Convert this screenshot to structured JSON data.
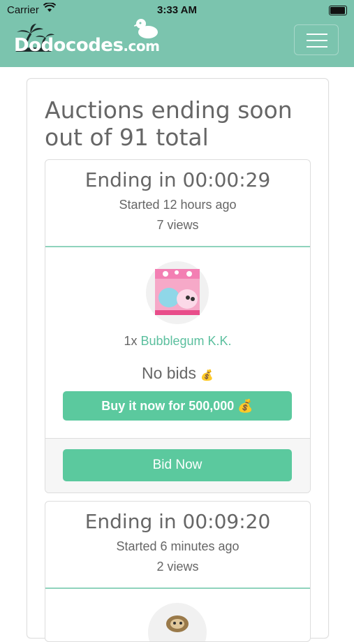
{
  "status": {
    "carrier": "Carrier",
    "time": "3:33 AM"
  },
  "nav": {
    "brand_a": "Dodo",
    "brand_b": "codes",
    "brand_c": ".com"
  },
  "page": {
    "title_line1": "Auctions ending soon",
    "title_line2": "out of 91 total"
  },
  "auctions": [
    {
      "ending": "Ending in 00:00:29",
      "started": "Started 12 hours ago",
      "views": "7 views",
      "quantity": "1x",
      "item_name": "Bubblegum K.K.",
      "bids": "No bids",
      "buy_now": "Buy it now for 500,000",
      "bid_button": "Bid Now"
    },
    {
      "ending": "Ending in 00:09:20",
      "started": "Started 6 minutes ago",
      "views": "2 views"
    }
  ],
  "colors": {
    "header": "#7bc4ae",
    "accent": "#5bc99e",
    "divider": "#8fd3bc"
  },
  "icons": {
    "bag": "money-bag-icon"
  }
}
